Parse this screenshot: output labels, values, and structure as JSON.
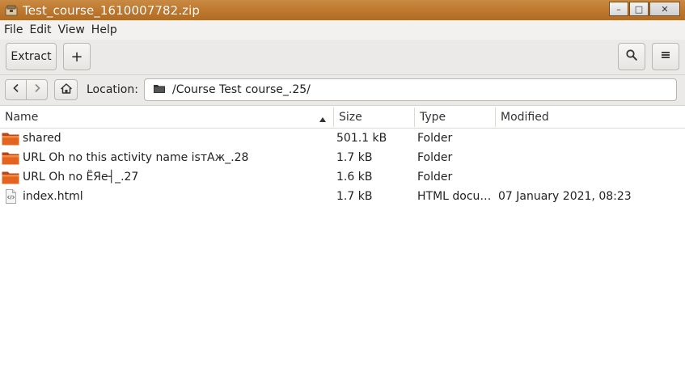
{
  "window": {
    "title": "Test_course_1610007782.zip",
    "controls": {
      "minimize": "–",
      "maximize": "□",
      "close": "✕"
    }
  },
  "menubar": {
    "items": [
      "File",
      "Edit",
      "View",
      "Help"
    ]
  },
  "toolbar": {
    "extract_label": "Extract",
    "add_label": "+",
    "search_icon": "search-icon",
    "menu_icon": "hamburger-menu-icon"
  },
  "location": {
    "label": "Location:",
    "path": "/Course Test course_.25/"
  },
  "columns": {
    "name": "Name",
    "size": "Size",
    "type": "Type",
    "modified": "Modified",
    "sort": "ascending"
  },
  "files": [
    {
      "name": "shared",
      "size": "501.1 kB",
      "type": "Folder",
      "modified": "",
      "icon": "folder-icon"
    },
    {
      "name": "URL Oh no this activity name isтАж_.28",
      "size": "1.7 kB",
      "type": "Folder",
      "modified": "",
      "icon": "folder-icon"
    },
    {
      "name": "URL Oh no ЁЯe┤_.27",
      "size": "1.6 kB",
      "type": "Folder",
      "modified": "",
      "icon": "folder-icon"
    },
    {
      "name": "index.html",
      "size": "1.7 kB",
      "type": "HTML docu…",
      "modified": "07 January 2021, 08:23",
      "icon": "html-file-icon"
    }
  ],
  "colors": {
    "titlebar": "#c07a30",
    "folder": "#e0601c",
    "chrome": "#ebeae8"
  }
}
